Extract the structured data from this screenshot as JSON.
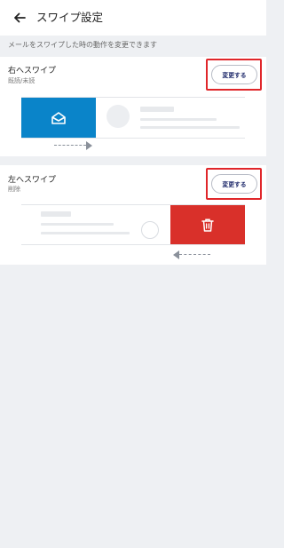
{
  "header": {
    "title": "スワイプ設定",
    "back_icon": "arrow-left-icon"
  },
  "description": "メールをスワイプした時の動作を変更できます",
  "right_swipe": {
    "title": "右へスワイプ",
    "action": "既読/未読",
    "button_label": "変更する",
    "action_icon": "envelope-open-icon",
    "action_color": "#0a84c9"
  },
  "left_swipe": {
    "title": "左へスワイプ",
    "action": "削除",
    "button_label": "変更する",
    "action_icon": "trash-icon",
    "action_color": "#d9302a"
  },
  "colors": {
    "highlight": "#e0262a",
    "button_text": "#1f2a6b",
    "background": "#eef0f3"
  }
}
